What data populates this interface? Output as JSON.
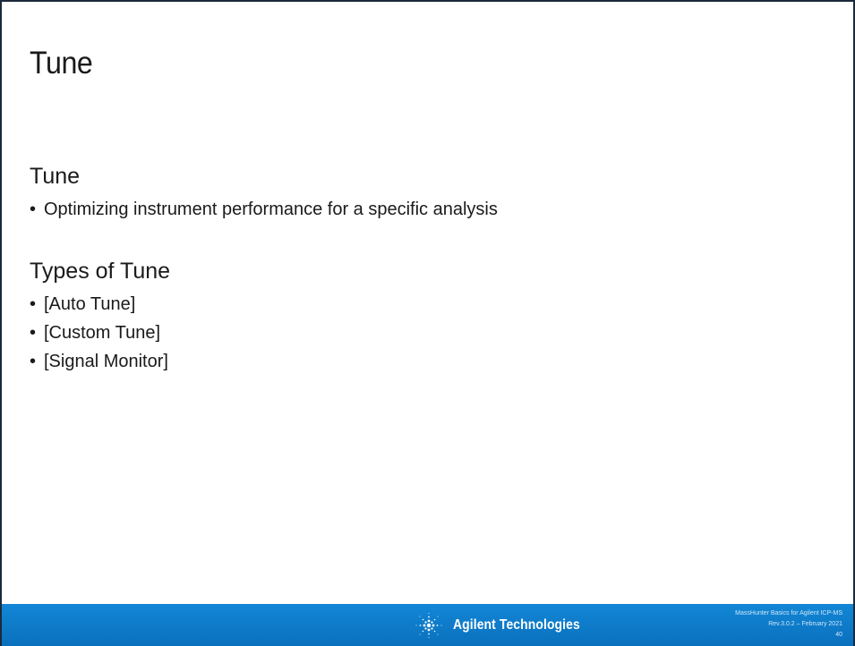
{
  "slide": {
    "title": "Tune",
    "sections": [
      {
        "heading": "Tune",
        "bullets": [
          "Optimizing instrument performance for a specific analysis"
        ]
      },
      {
        "heading": "Types of Tune",
        "bullets": [
          "[Auto Tune]",
          "[Custom Tune]",
          "[Signal Monitor]"
        ]
      }
    ]
  },
  "footer": {
    "logo_text": "Agilent Technologies",
    "logo_icon": "agilent-spark-icon",
    "meta_lines": [
      "MassHunter Basics for Agilent ICP-MS",
      "Rev.3.0.2 – February 2021",
      "40"
    ]
  },
  "colors": {
    "footer_blue": "#0a70bd",
    "text": "#1a1a1a",
    "frame": "#1a2a3a"
  }
}
